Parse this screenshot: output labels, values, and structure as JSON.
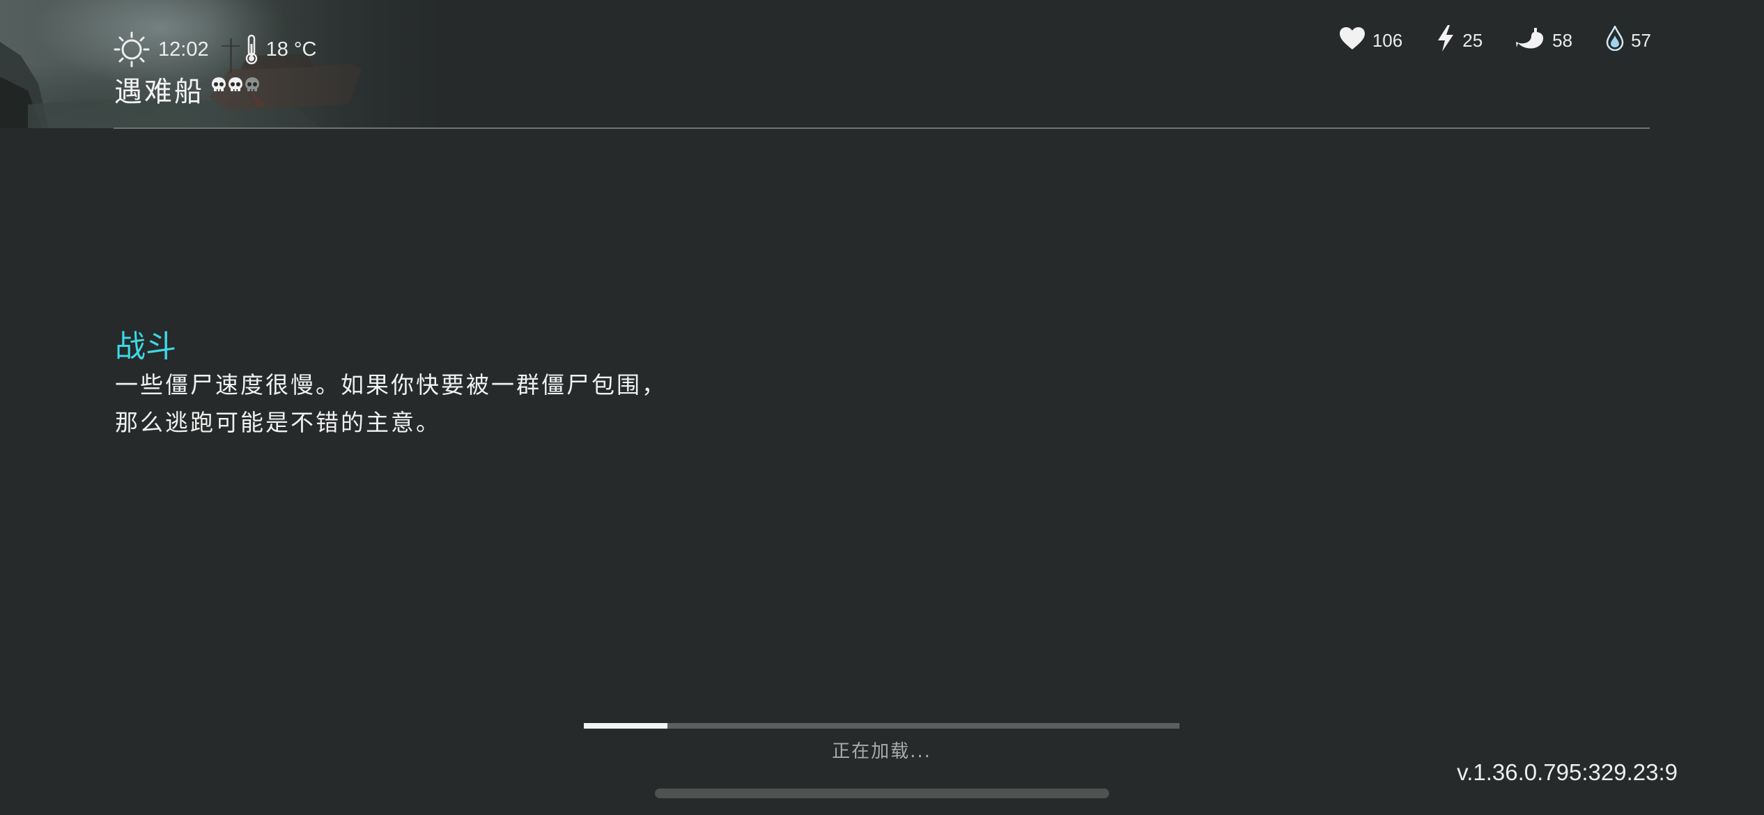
{
  "hud": {
    "weather_icon": "sun-icon",
    "time": "12:02",
    "temperature_icon": "thermometer-icon",
    "temperature": "18 °C",
    "location_name": "遇难船",
    "danger_level": 2,
    "danger_max": 3,
    "danger_icon": "skull-icon"
  },
  "stats": {
    "health": {
      "icon": "heart-icon",
      "value": "106"
    },
    "energy": {
      "icon": "lightning-icon",
      "value": "25"
    },
    "food": {
      "icon": "stomach-icon",
      "value": "58"
    },
    "water": {
      "icon": "water-drop-icon",
      "value": "57"
    }
  },
  "tip": {
    "title": "战斗",
    "line1": "一些僵尸速度很慢。如果你快要被一群僵尸包围，",
    "line2": "那么逃跑可能是不错的主意。"
  },
  "loading": {
    "progress": 0.14,
    "label": "正在加载..."
  },
  "version": "v.1.36.0.795:329.23:9",
  "colors": {
    "background": "#262a2a",
    "tip_title": "#3fd7e6",
    "text": "#f1f1f1",
    "progress_fill": "#f4f4f4",
    "progress_track": "#5b5f5e"
  }
}
